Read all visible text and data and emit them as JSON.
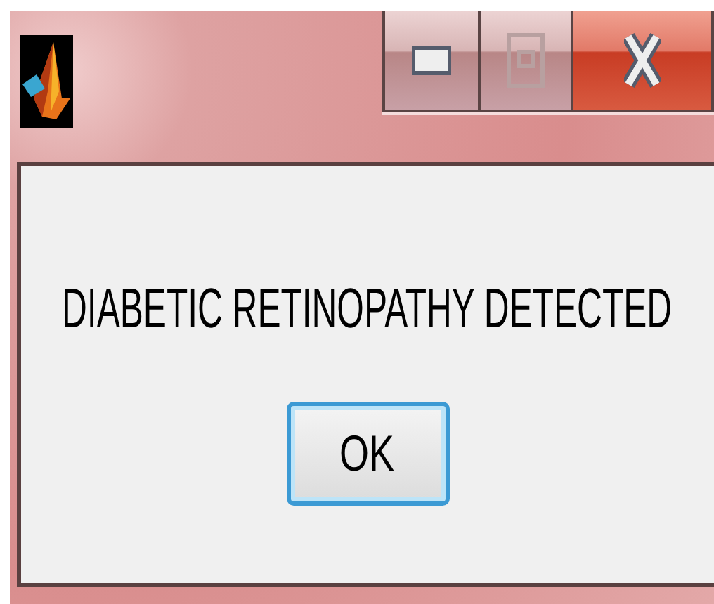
{
  "window": {
    "maximize_disabled": true
  },
  "message": "DIABETIC RETINOPATHY DETECTED",
  "buttons": [
    {
      "label": "OK",
      "focused": true
    }
  ]
}
